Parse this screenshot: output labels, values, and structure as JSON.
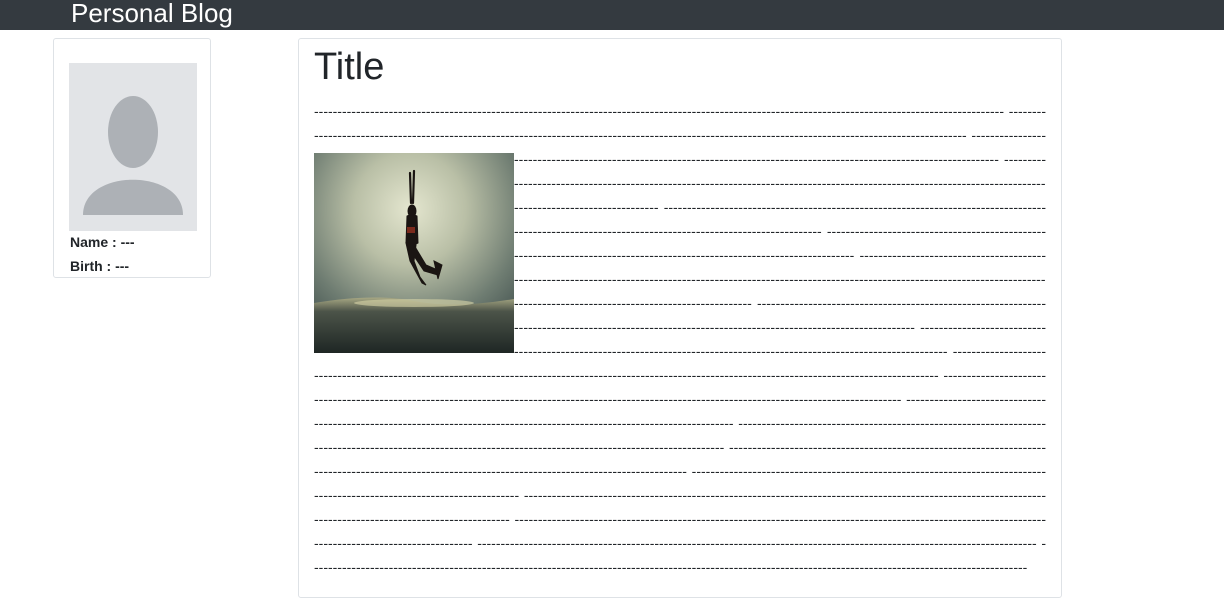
{
  "navbar": {
    "brand": "Personal Blog"
  },
  "profile": {
    "name_label": "Name : ---",
    "birth_label": "Birth : ---"
  },
  "post": {
    "title": "Title",
    "body": "---------------------------------------------------------------------------------------------------------------------------------------------------- ---------------------------------------------------------------------------------------------------------------------------------------------------- ------------------------------------------------------------------------------------------------------------------------ ---------------------------------------------------------------------------------------------------------------------------------------------------------- ---------------------------------------------------------------------------------------------------------------------------------------------------- ------------------------------------------------------------------------------------------------------------------------ ------------------------------------------------------------------------------------------------------------------------------------------------------------------------------------------------------------- ---------------------------------------------------------------------------------------------------------------------------------------------------- ------------------------------------------------------------------------------------------------------------------------ ---------------------------------------------------------------------------------------------------------------------------------------------------------- ---------------------------------------------------------------------------------------------------------------------------------------------------- ------------------------------------------------------------------------------------------------------------------------ ---------------------------------------------------------------------------------------------------------------------------------------------------------- ---------------------------------------------------------------------------------------------------------------------------------------------------- ------------------------------------------------------------------------------------------------------------------------ ---------------------------------------------------------------------------------------------------------------------------------------------------------- ---------------------------------------------------------------------------------------------------------------------------------------------------- ------------------------------------------------------------------------------------------------------------------------ ----------------------------------------------------------------------------------------------------------------------------------------------------------"
  }
}
